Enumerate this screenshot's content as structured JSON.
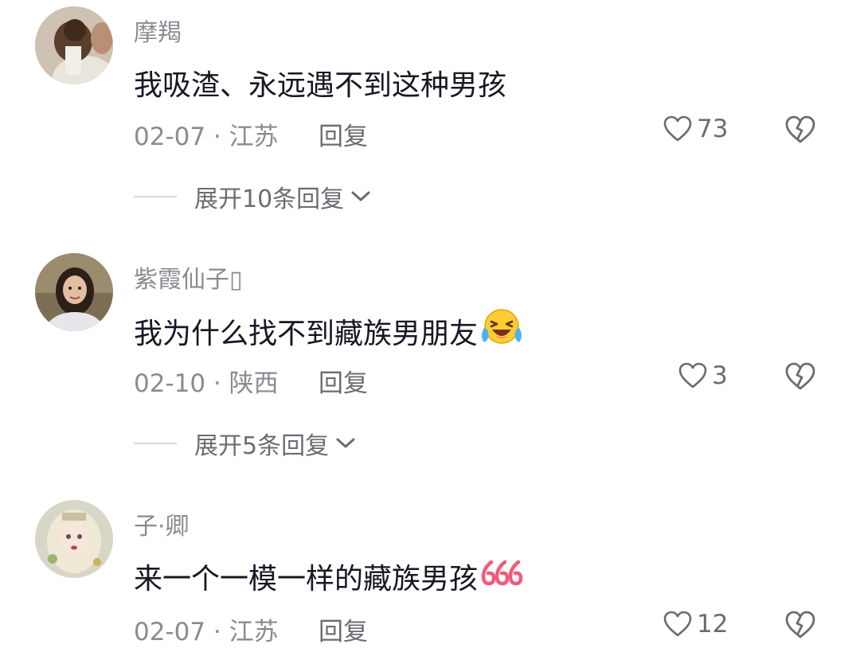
{
  "comments": [
    {
      "username": "摩羯",
      "text": "我吸渣、永远遇不到这种男孩",
      "meta": "02-07 · 江苏",
      "reply_label": "回复",
      "likes": "73",
      "expand_label": "展开10条回复",
      "avatar_icon": "avatar-bun-hair"
    },
    {
      "username": "紫霞仙子▯",
      "text": "我为什么找不到藏族男朋友",
      "emoji": "laughing-tears-emoji",
      "meta": "02-10 · 陕西",
      "reply_label": "回复",
      "likes": "3",
      "expand_label": "展开5条回复",
      "avatar_icon": "avatar-woman-portrait"
    },
    {
      "username": "子·卿",
      "text": "来一个一模一样的藏族男孩",
      "emoji": "666-emoji",
      "meta": "02-07 · 江苏",
      "reply_label": "回复",
      "likes": "12",
      "avatar_icon": "avatar-anime-girl"
    }
  ],
  "icons": {
    "like": "heart-outline-icon",
    "dislike": "broken-heart-icon",
    "expand": "chevron-down-icon"
  },
  "colors": {
    "text_primary": "#161823",
    "text_secondary": "#8a8b91",
    "emoji_666": "#f25a7a"
  }
}
